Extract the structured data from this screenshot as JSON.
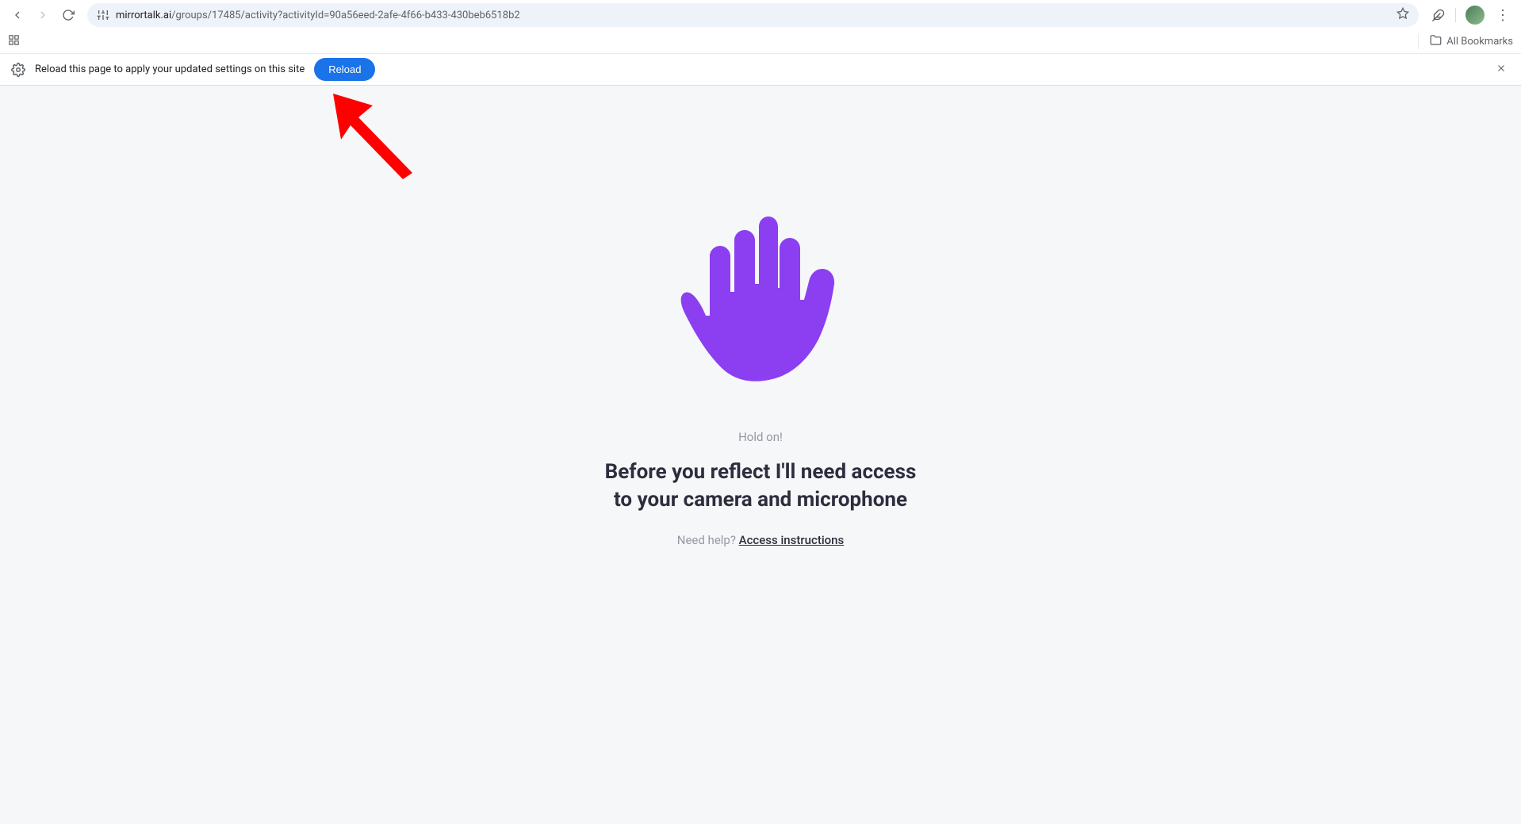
{
  "browser": {
    "url_domain": "mirrortalk.ai",
    "url_path": "/groups/17485/activity?activityId=90a56eed-2afe-4f66-b433-430beb6518b2",
    "all_bookmarks_label": "All Bookmarks"
  },
  "infobar": {
    "message": "Reload this page to apply your updated settings on this site",
    "reload_label": "Reload"
  },
  "page": {
    "hold_on": "Hold on!",
    "heading_line1": "Before you reflect I'll need access",
    "heading_line2": "to your camera and microphone",
    "help_prefix": "Need help? ",
    "access_link": "Access instructions"
  },
  "colors": {
    "hand_purple": "#8b3ff0",
    "reload_blue": "#1a73e8",
    "arrow_red": "#ff0000"
  }
}
